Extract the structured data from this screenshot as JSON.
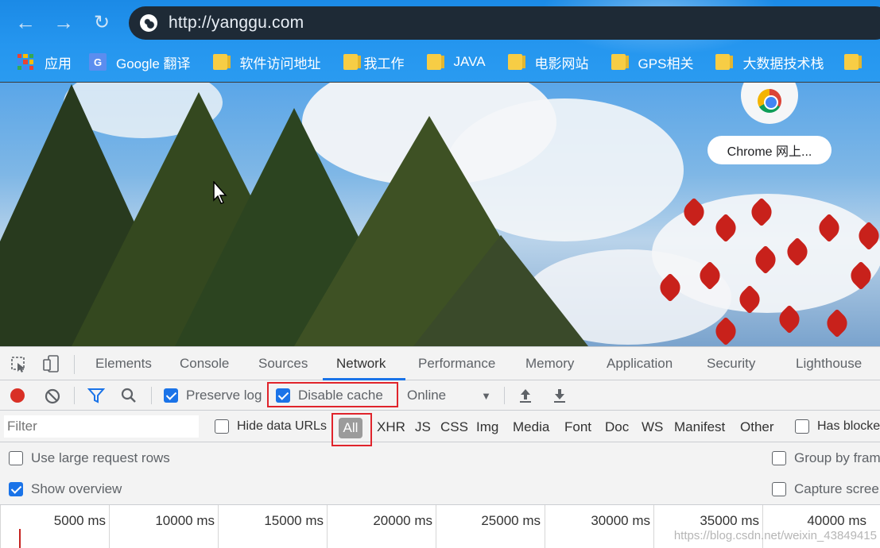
{
  "browser": {
    "url": "http://yanggu.com",
    "bookmarks": [
      {
        "label": "应用",
        "icon": "apps-grid-icon"
      },
      {
        "label": "Google 翻译",
        "icon": "google-translate-icon"
      },
      {
        "label": "软件访问地址",
        "icon": "folder-icon"
      },
      {
        "label": "我工作",
        "icon": "folder-icon"
      },
      {
        "label": "JAVA",
        "icon": "folder-icon"
      },
      {
        "label": "电影网站",
        "icon": "folder-icon"
      },
      {
        "label": "GPS相关",
        "icon": "folder-icon"
      },
      {
        "label": "大数据技术栈",
        "icon": "folder-icon"
      }
    ]
  },
  "page": {
    "store_label": "Chrome 网上..."
  },
  "devtools": {
    "tabs": [
      "Elements",
      "Console",
      "Sources",
      "Network",
      "Performance",
      "Memory",
      "Application",
      "Security",
      "Lighthouse"
    ],
    "active_tab": "Network",
    "toolbar": {
      "preserve_log": "Preserve log",
      "preserve_log_checked": true,
      "disable_cache": "Disable cache",
      "disable_cache_checked": true,
      "throttling": "Online"
    },
    "filter": {
      "placeholder": "Filter",
      "hide_data_urls": "Hide data URLs",
      "types": [
        "All",
        "XHR",
        "JS",
        "CSS",
        "Img",
        "Media",
        "Font",
        "Doc",
        "WS",
        "Manifest",
        "Other"
      ],
      "active_type": "All",
      "has_blocked": "Has blocke"
    },
    "options": {
      "use_large_rows": "Use large request rows",
      "group_by_frame": "Group by fram",
      "show_overview": "Show overview",
      "show_overview_checked": true,
      "capture_screenshots": "Capture scree"
    },
    "timeline_ticks": [
      "5000 ms",
      "10000 ms",
      "15000 ms",
      "20000 ms",
      "25000 ms",
      "30000 ms",
      "35000 ms",
      "40000 ms"
    ],
    "watermark": "https://blog.csdn.net/weixin_43849415"
  },
  "colors": {
    "accent": "#1a73e8",
    "record": "#d93025",
    "highlight_box": "#e0242c"
  }
}
